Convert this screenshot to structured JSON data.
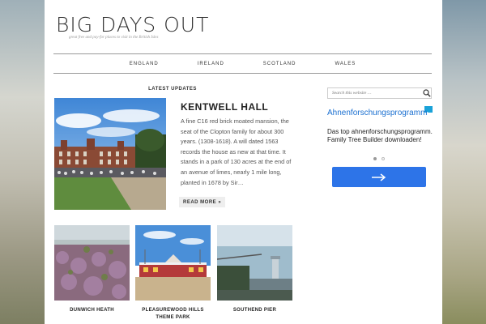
{
  "site": {
    "title": "BIG DAYS OUT",
    "tagline": "great free and pay-for places to visit in the British Isles"
  },
  "nav": [
    "ENGLAND",
    "IRELAND",
    "SCOTLAND",
    "WALES"
  ],
  "main": {
    "section_heading": "LATEST UPDATES",
    "feature": {
      "title": "KENTWELL HALL",
      "excerpt": "A fine C16 red brick moated mansion, the seat of the Clopton family for about 300 years. (1308-1618). A will dated 1563 records the house as new at that time. It stands in a park of 130 acres at the end of an avenue of limes, nearly 1 mile long, planted in 1678 by Sir…",
      "read_more": "READ MORE »"
    },
    "thumbnails": [
      {
        "caption": "DUNWICH HEATH"
      },
      {
        "caption": "PLEASUREWOOD HILLS THEME PARK"
      },
      {
        "caption": "SOUTHEND PIER"
      }
    ]
  },
  "sidebar": {
    "search_placeholder": "Search this website …",
    "ad": {
      "title": "Ahnenforschungsprogramm",
      "text": "Das top ahnenforschungsprogramm. Family Tree Builder downloaden!"
    }
  },
  "colors": {
    "ad_link": "#1a6fd0",
    "ad_button": "#2d74e8",
    "nav_border": "#999999"
  }
}
